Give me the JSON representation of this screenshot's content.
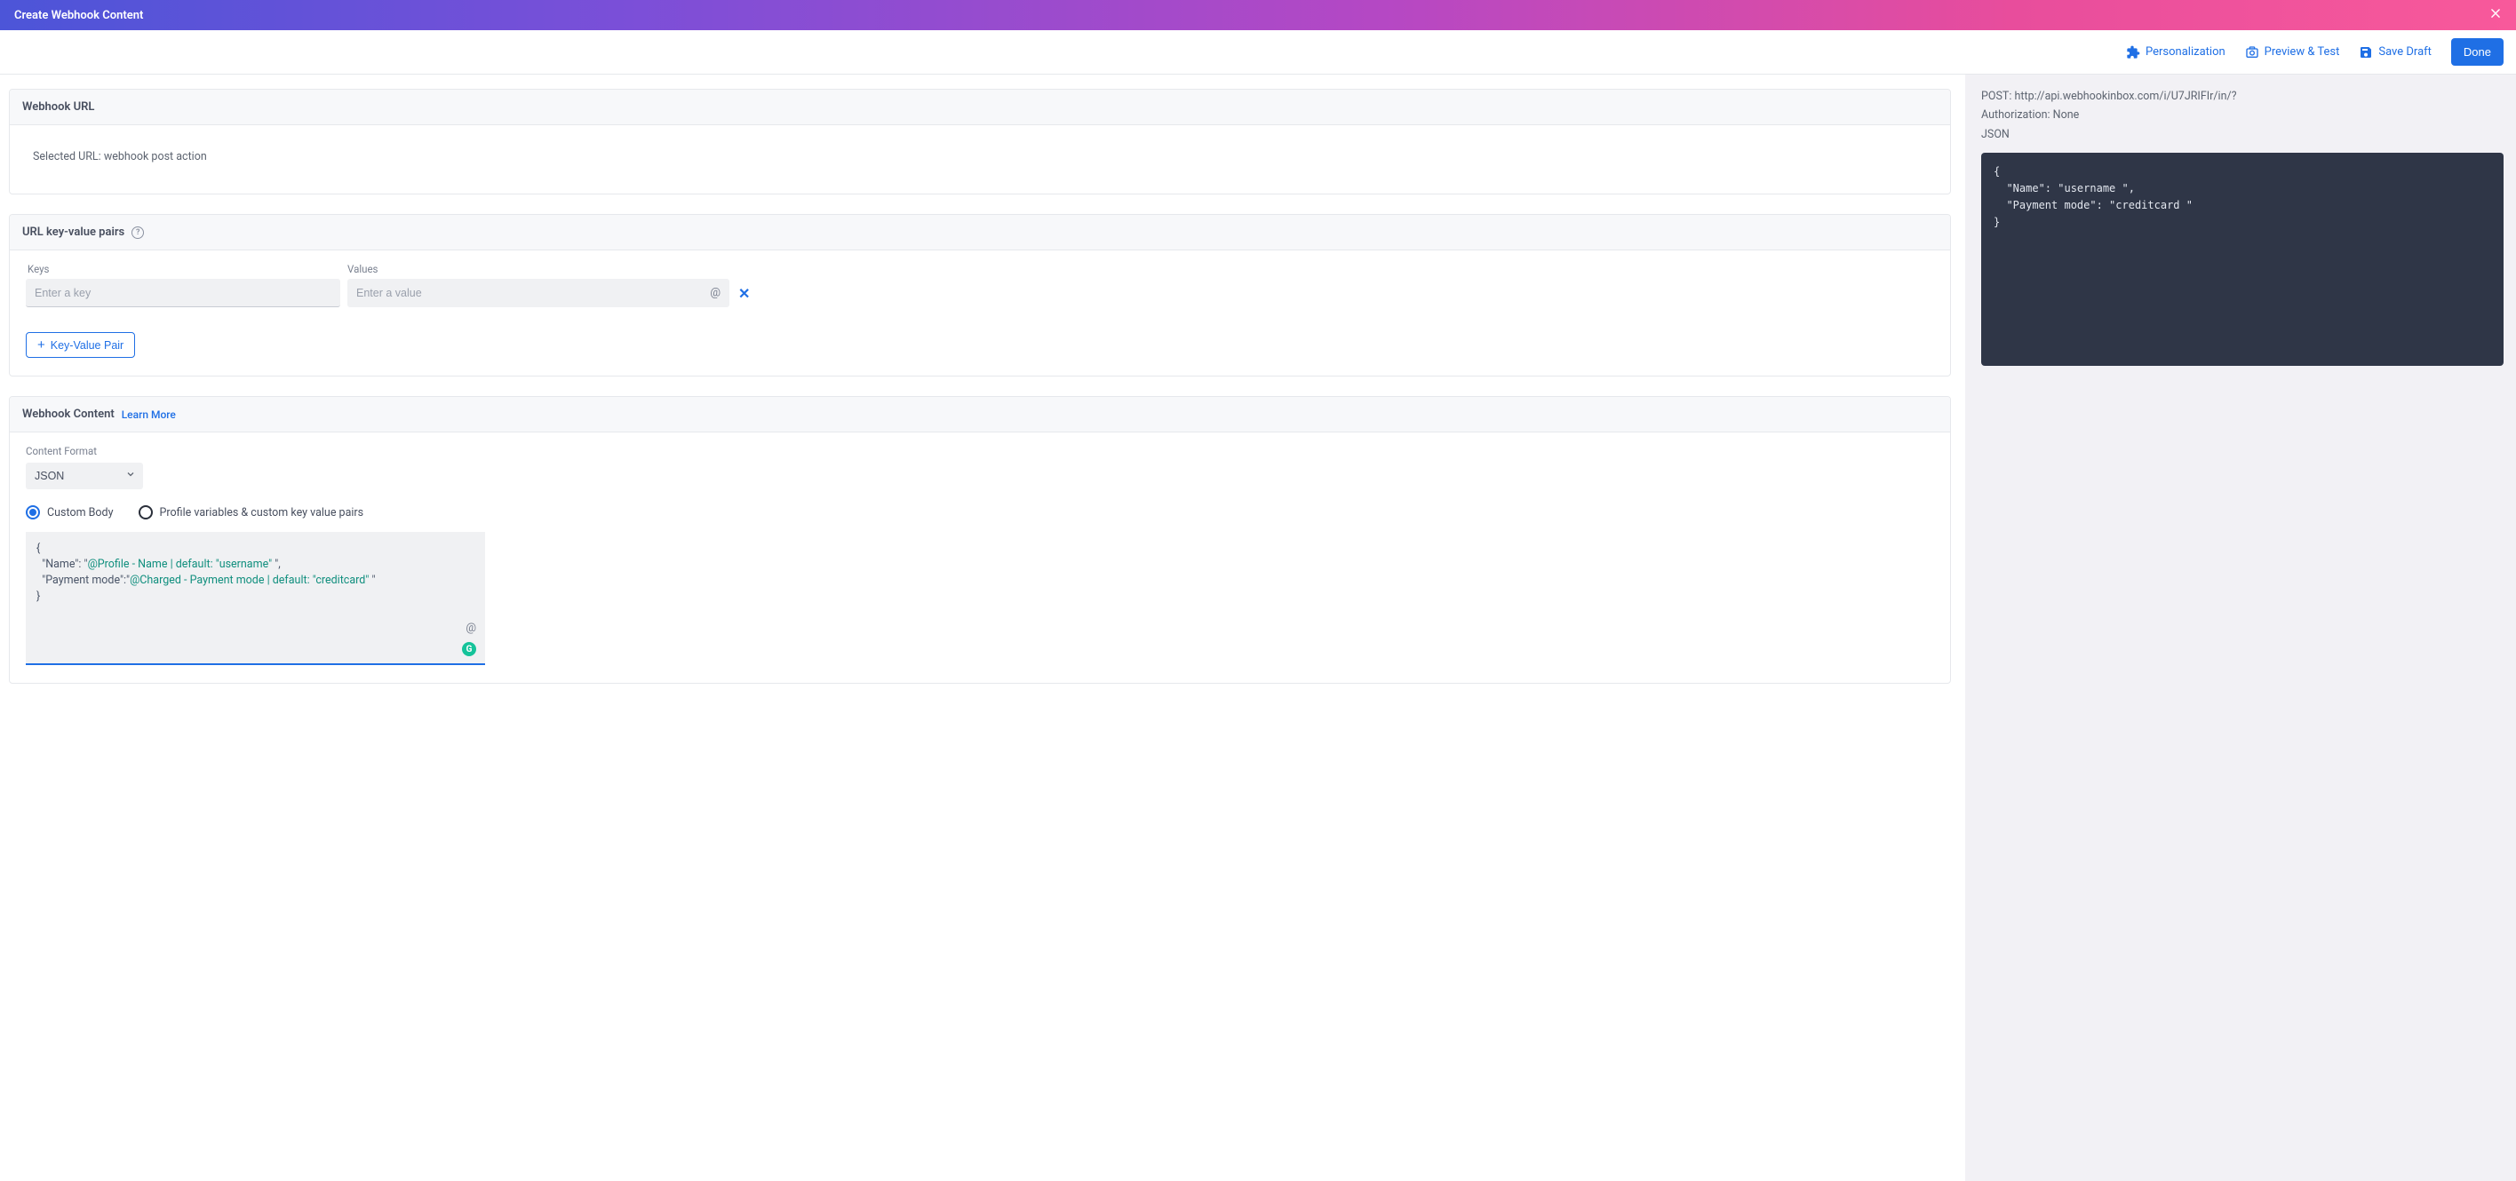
{
  "header": {
    "title": "Create Webhook Content"
  },
  "toolbar": {
    "personalization": "Personalization",
    "preview_test": "Preview & Test",
    "save_draft": "Save Draft",
    "done": "Done"
  },
  "webhook_url": {
    "section_title": "Webhook URL",
    "selected_label": "Selected URL:",
    "selected_value": "webhook post action"
  },
  "kv_section": {
    "section_title": "URL key-value pairs",
    "keys_label": "Keys",
    "values_label": "Values",
    "key_placeholder": "Enter a key",
    "value_placeholder": "Enter a value",
    "at_glyph": "@",
    "remove_glyph": "✕",
    "add_btn_label": "Key-Value Pair"
  },
  "content_section": {
    "section_title": "Webhook Content",
    "learn_more": "Learn More",
    "content_format_label": "Content Format",
    "format_selected": "JSON",
    "radio_custom": "Custom Body",
    "radio_profile": "Profile variables & custom key value pairs",
    "custom_body": {
      "line1_open": "{",
      "line2_pre": "  \"Name\": \"",
      "line2_tpl": "@Profile - Name | default: \"username\" ",
      "line2_post": "\",",
      "line3_pre": "  \"Payment mode\":\"",
      "line3_tpl": "@Charged - Payment mode | default: \"creditcard\" ",
      "line3_post": "\"",
      "line4_close": "}",
      "at_glyph": "@"
    }
  },
  "preview": {
    "meta_method_label": "POST:",
    "meta_url": "http://api.webhookinbox.com/i/U7JRIFIr/in/?",
    "meta_auth_label": "Authorization:",
    "meta_auth_value": "None",
    "meta_format": "JSON",
    "code": "{\n  \"Name\": \"username \",\n  \"Payment mode\": \"creditcard \"\n}"
  }
}
